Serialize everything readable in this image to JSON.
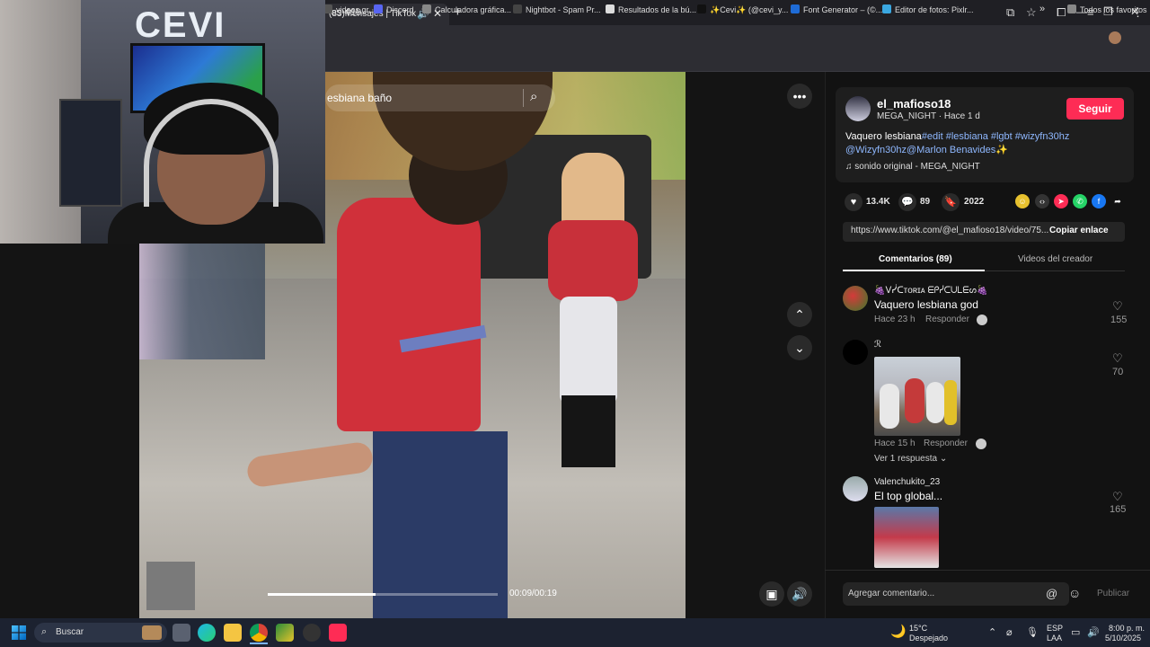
{
  "browser": {
    "tab_title": "(83)Mensajes | TikTok",
    "tab_audio_icon": "speaker-icon",
    "url_fragment": "=es-419",
    "bookmarks": [
      {
        "label": "videos gr...",
        "color": "#555"
      },
      {
        "label": "Discord",
        "color": "#5865f2"
      },
      {
        "label": "Calculadora gráfica...",
        "color": "#888"
      },
      {
        "label": "Nightbot - Spam Pr...",
        "color": "#444"
      },
      {
        "label": "Resultados de la bú...",
        "color": "#ddd"
      },
      {
        "label": "✨Cevi✨ (@cevi_y...",
        "color": "#111"
      },
      {
        "label": "Font Generator – (©...",
        "color": "#1e6bd6"
      },
      {
        "label": "Editor de fotos: Pixlr...",
        "color": "#3aa7e0"
      }
    ],
    "all_favorites": "Todos los favoritos"
  },
  "webcam": {
    "sign_text": "CEVI"
  },
  "video": {
    "search_text": "esbiana baño",
    "time": "00:09/00:19",
    "progress": 0.47
  },
  "post": {
    "username": "el_mafioso18",
    "subline": "MEGA_NIGHT · Hace 1 d",
    "follow_label": "Seguir",
    "caption_plain": "Vaquero lesbiana",
    "caption_tags_1": "#edit #lesbiana #lgbt #wizyfn30hz",
    "caption_tags_2": "@Wizyfn30hz@Marlon Benavides",
    "caption_sparkle": "✨",
    "sound": "sonido original - MEGA_NIGHT",
    "likes": "13.4K",
    "comments": "89",
    "saves": "2022",
    "link": "https://www.tiktok.com/@el_mafioso18/video/75...",
    "copy_label": "Copiar enlace",
    "tab_comments": "Comentarios (89)",
    "tab_videos": "Videos del creador"
  },
  "comments": [
    {
      "user": "🍇ᐯᓰᑕᴛᴏʀɪᴀ ᗴᑭᓰᑕᑌᒪᗴᔕ🍇",
      "text": "Vaquero lesbiana god",
      "time": "Hace 23 h",
      "reply": "Responder",
      "likes": "155"
    },
    {
      "user": "ℛ",
      "text": "",
      "time": "Hace 15 h",
      "reply": "Responder",
      "likes": "70",
      "more": "Ver 1 respuesta"
    },
    {
      "user": "Valenchukito_23",
      "text": "El top global...",
      "likes": "165"
    }
  ],
  "add_comment": {
    "placeholder": "Agregar comentario...",
    "publish": "Publicar"
  },
  "taskbar": {
    "search": "Buscar",
    "weather_temp": "15°C",
    "weather_desc": "Despejado",
    "lang_1": "ESP",
    "lang_2": "LAA",
    "time": "8:00 p. m.",
    "date": "5/10/2025"
  }
}
